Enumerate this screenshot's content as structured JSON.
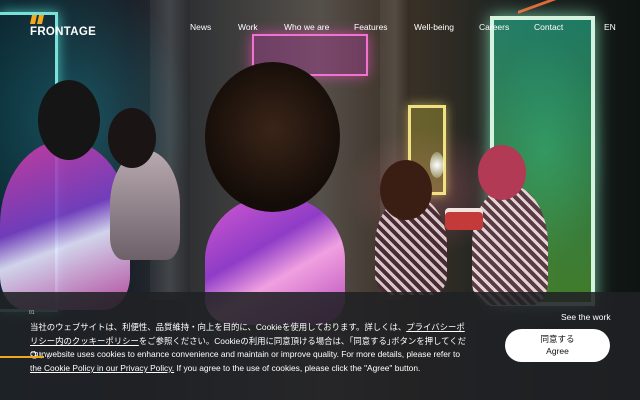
{
  "header": {
    "logo_text": "FRONTAGE",
    "brand_accent": "#f3a71c",
    "nav": [
      {
        "label": "News"
      },
      {
        "label": "Work"
      },
      {
        "label": "Who we are"
      },
      {
        "label": "Features"
      },
      {
        "label": "Well-being"
      },
      {
        "label": "Careers"
      },
      {
        "label": "Contact"
      },
      {
        "label": "EN"
      }
    ]
  },
  "hero": {
    "see_work_label": "See the work",
    "slide_counter": "01"
  },
  "cookie_banner": {
    "ja_text_before": "当社のウェブサイトは、利便性、品質維持・向上を目的に、Cookieを使用しております。詳しくは、",
    "ja_link": "プライバシーポリシー内のクッキーポリシー",
    "ja_text_after": "をご参照ください。Cookieの利用に同意頂ける場合は、｢同意する｣ボタンを押してください。",
    "en_text_before": "Our website uses cookies to enhance convenience and maintain or improve quality. For more details, please refer to ",
    "en_link": "the Cookie Policy in our Privacy Policy.",
    "en_text_after": " If you agree to the use of cookies, please click the \"Agree\" button.",
    "agree_ja": "同意する",
    "agree_en": "Agree"
  }
}
